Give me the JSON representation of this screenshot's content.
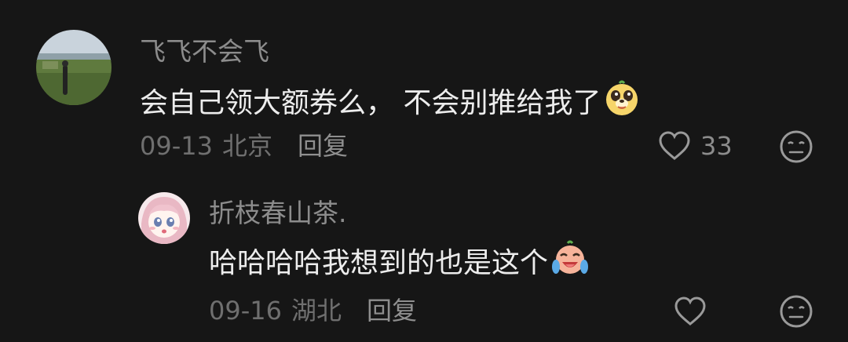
{
  "colors": {
    "background": "#161616",
    "username": "#8c8c8c",
    "content": "#ededed",
    "meta": "#6f6f6f",
    "icon": "#9a9a9a"
  },
  "comments": [
    {
      "username": "飞飞不会飞",
      "content": "会自己领大额券么， 不会别推给我了",
      "emoji": "dog-face-emoji",
      "date": "09-13",
      "location": "北京",
      "reply_label": "回复",
      "like_count": "33",
      "avatar": "landscape-photo-avatar"
    },
    {
      "username": "折枝春山茶.",
      "content": "哈哈哈哈我想到的也是这个",
      "emoji": "crying-laughing-emoji",
      "date": "09-16",
      "location": "湖北",
      "reply_label": "回复",
      "like_count": "",
      "avatar": "anime-girl-avatar"
    }
  ]
}
